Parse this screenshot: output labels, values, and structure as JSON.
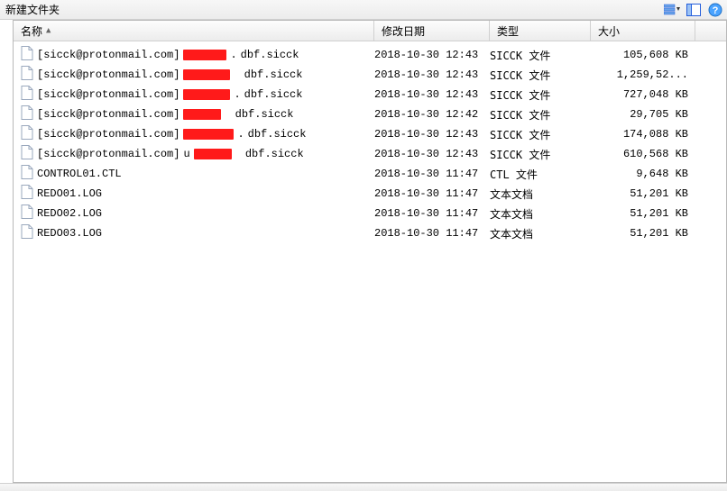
{
  "window": {
    "title": "新建文件夹"
  },
  "toolbar_icons": {
    "views": "views-icon",
    "panel": "panel-icon",
    "help": "help-icon"
  },
  "columns": {
    "name": "名称",
    "date": "修改日期",
    "type": "类型",
    "size": "大小"
  },
  "size_unit": "KB",
  "files": [
    {
      "prefix": "[sicck@protonmail.com]",
      "redact_before": false,
      "redact_width": 48,
      "redact_after": ".",
      "suffix": "dbf.sicck",
      "date": "2018-10-30 12:43",
      "type": "SICCK 文件",
      "size": "105,608 KB"
    },
    {
      "prefix": "[sicck@protonmail.com]",
      "redact_before": false,
      "redact_width": 52,
      "redact_after": " ",
      "suffix": "dbf.sicck",
      "date": "2018-10-30 12:43",
      "type": "SICCK 文件",
      "size": "1,259,52..."
    },
    {
      "prefix": "[sicck@protonmail.com]",
      "redact_before": false,
      "redact_width": 52,
      "redact_after": ".",
      "suffix": "dbf.sicck",
      "date": "2018-10-30 12:43",
      "type": "SICCK 文件",
      "size": "727,048 KB"
    },
    {
      "prefix": "[sicck@protonmail.com]",
      "redact_before": false,
      "redact_width": 42,
      "redact_after": " ",
      "suffix": "dbf.sicck",
      "date": "2018-10-30 12:42",
      "type": "SICCK 文件",
      "size": "29,705 KB"
    },
    {
      "prefix": "[sicck@protonmail.com]",
      "redact_before": false,
      "redact_width": 56,
      "redact_after": ".",
      "suffix": "dbf.sicck",
      "date": "2018-10-30 12:43",
      "type": "SICCK 文件",
      "size": "174,088 KB"
    },
    {
      "prefix": "[sicck@protonmail.com]",
      "redact_before": true,
      "redact_width": 42,
      "redact_after": " ",
      "suffix": "dbf.sicck",
      "date": "2018-10-30 12:43",
      "type": "SICCK 文件",
      "size": "610,568 KB"
    },
    {
      "prefix": "CONTROL01.CTL",
      "redact_before": false,
      "redact_width": 0,
      "redact_after": "",
      "suffix": "",
      "date": "2018-10-30 11:47",
      "type": "CTL 文件",
      "size": "9,648 KB"
    },
    {
      "prefix": "REDO01.LOG",
      "redact_before": false,
      "redact_width": 0,
      "redact_after": "",
      "suffix": "",
      "date": "2018-10-30 11:47",
      "type": "文本文档",
      "size": "51,201 KB"
    },
    {
      "prefix": "REDO02.LOG",
      "redact_before": false,
      "redact_width": 0,
      "redact_after": "",
      "suffix": "",
      "date": "2018-10-30 11:47",
      "type": "文本文档",
      "size": "51,201 KB"
    },
    {
      "prefix": "REDO03.LOG",
      "redact_before": false,
      "redact_width": 0,
      "redact_after": "",
      "suffix": "",
      "date": "2018-10-30 11:47",
      "type": "文本文档",
      "size": "51,201 KB"
    }
  ]
}
